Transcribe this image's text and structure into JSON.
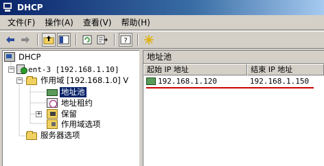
{
  "window": {
    "title": "DHCP"
  },
  "menu": [
    "文件(F)",
    "操作(A)",
    "查看(V)",
    "帮助(H)"
  ],
  "toolbar": {
    "buttons": [
      "back-arrow-icon",
      "forward-arrow-icon",
      "up-folder-icon",
      "show-tree-icon",
      "refresh-icon",
      "export-list-icon",
      "help-icon",
      "wizard-icon"
    ]
  },
  "tree": {
    "root": "DHCP",
    "server": "ent-3 [192.168.1.10]",
    "scope": "作用域 [192.168.1.0] V",
    "pool": "地址池",
    "leases": "地址租约",
    "reservations": "保留",
    "scope_options": "作用域选项",
    "server_options": "服务器选项"
  },
  "rightpane": {
    "title": "地址池",
    "columns": [
      "起始 IP 地址",
      "结束 IP 地址"
    ],
    "rows": [
      {
        "start": "192.168.1.120",
        "end": "192.168.1.150"
      }
    ]
  }
}
